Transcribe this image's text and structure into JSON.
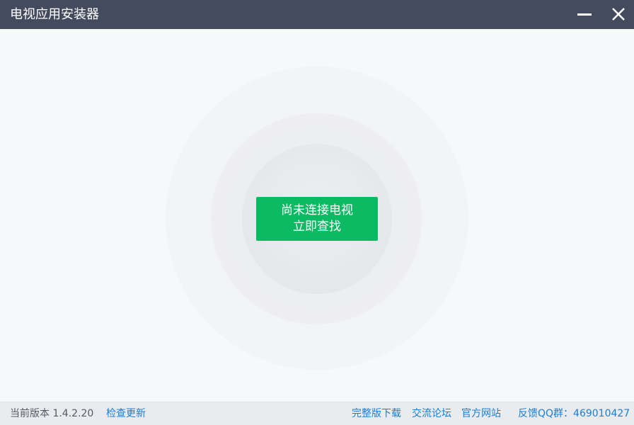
{
  "window": {
    "title": "电视应用安装器"
  },
  "main": {
    "connect_button": {
      "line1": "尚未连接电视",
      "line2": "立即查找"
    }
  },
  "footer": {
    "version_text": "当前版本 1.4.2.20",
    "check_update": "检查更新",
    "full_download": "完整版下载",
    "forum": "交流论坛",
    "official_site": "官方网站",
    "feedback_qq": "反馈QQ群：469010427"
  },
  "colors": {
    "titlebar": "#444b5e",
    "accent_green": "#0dba64",
    "link_blue": "#1a7fd0",
    "background": "#f7f8fa"
  },
  "icons": {
    "minimize": "minimize-icon",
    "close": "close-icon"
  }
}
